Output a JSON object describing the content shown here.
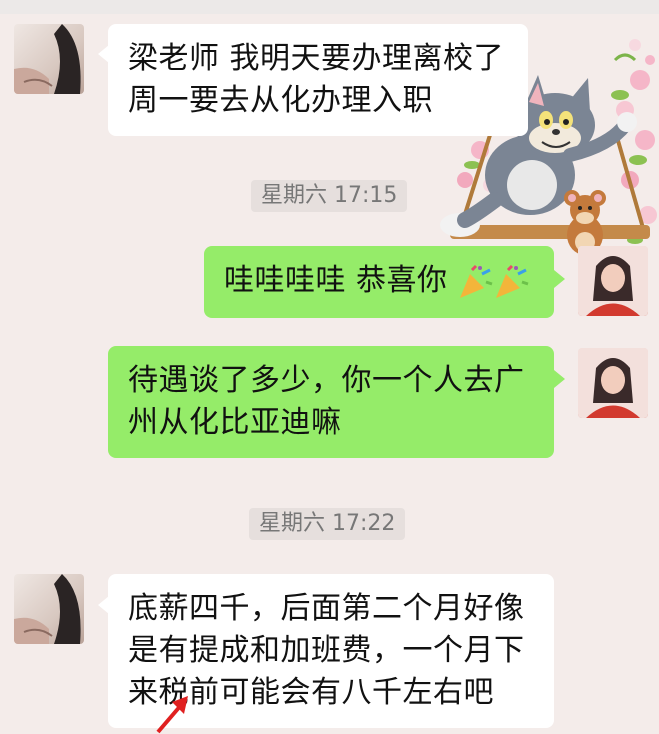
{
  "messages": [
    {
      "side": "left",
      "text_line1": "梁老师 我明天要办理离校了",
      "text_line2": "周一要去从化办理入职"
    },
    {
      "timestamp": "星期六 17:15"
    },
    {
      "side": "right",
      "text": "哇哇哇哇 恭喜你",
      "emoji": [
        "party-popper-icon",
        "party-popper-icon"
      ]
    },
    {
      "side": "right",
      "text_line1": "待遇谈了多少，你一个人去广",
      "text_line2": "州从化比亚迪嘛"
    },
    {
      "timestamp": "星期六 17:22"
    },
    {
      "side": "left",
      "text_line1": "底薪四千，后面第二个月好像",
      "text_line2": "是有提成和加班费，一个月下",
      "text_line3": "来税前可能会有八千左右吧"
    }
  ],
  "colors": {
    "background": "#f4ecea",
    "incoming_bubble": "#ffffff",
    "outgoing_bubble": "#95ec69",
    "arrow": "#e02020"
  }
}
